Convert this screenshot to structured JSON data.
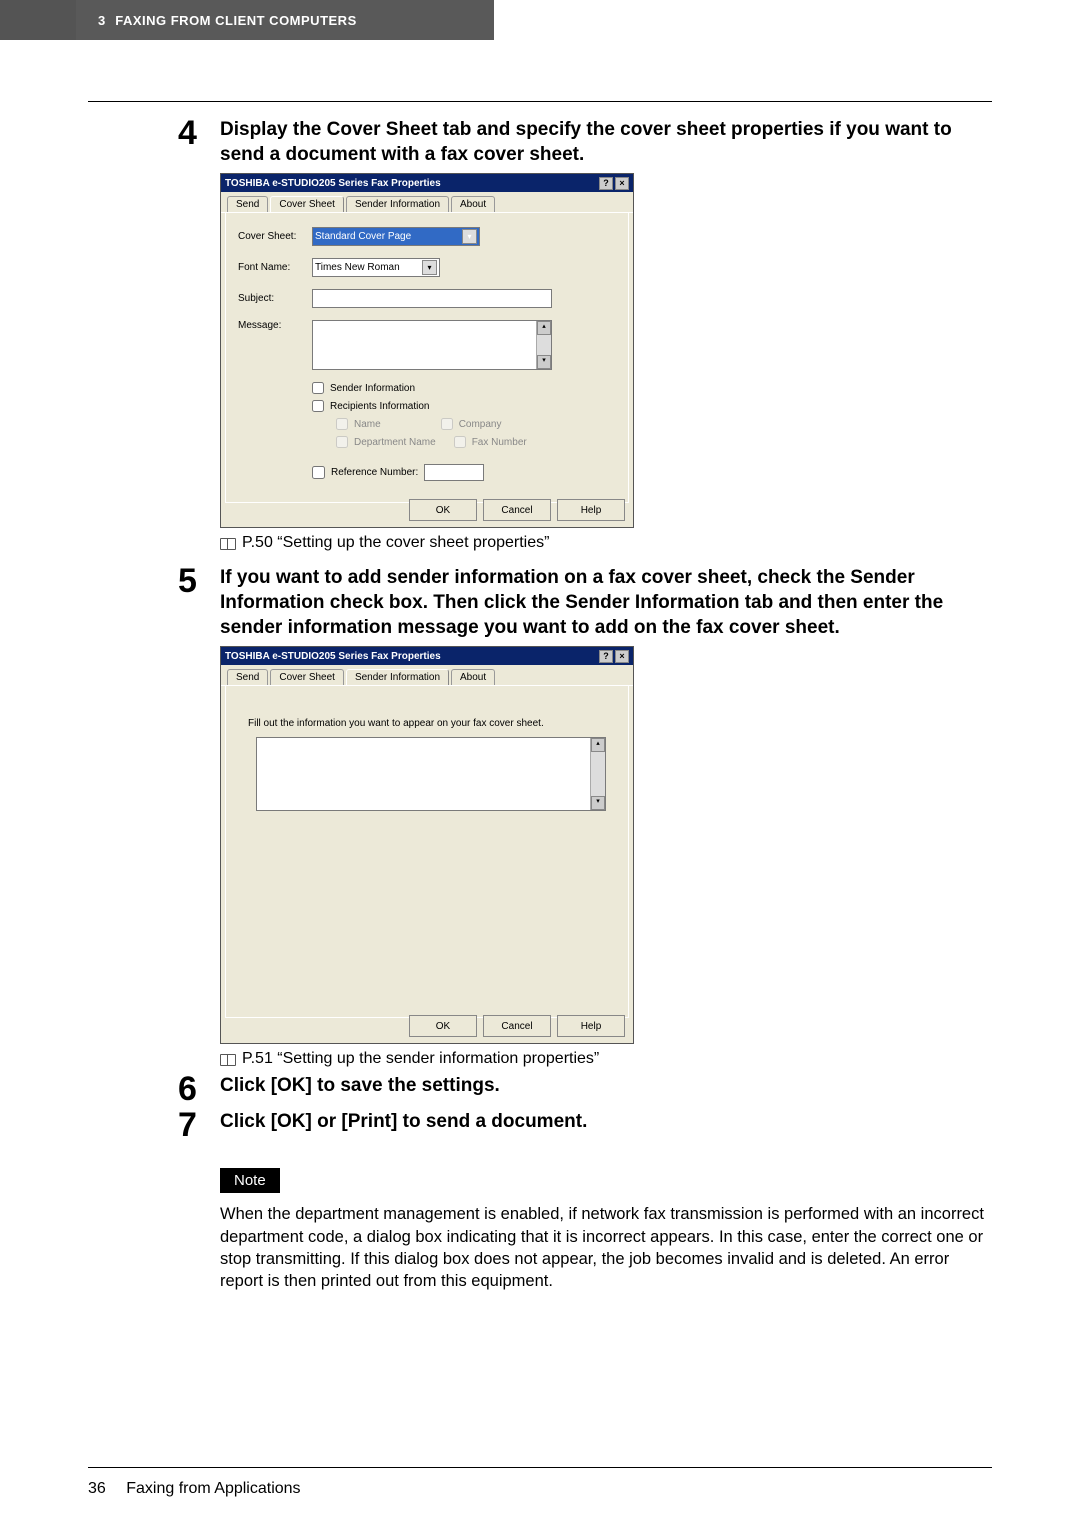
{
  "header": {
    "chapter_num": "3",
    "chapter_title": "FAXING FROM CLIENT COMPUTERS"
  },
  "steps": {
    "s4": {
      "num": "4",
      "text": "Display the Cover Sheet tab and specify the cover sheet properties if you want to send a document with a fax cover sheet."
    },
    "s5": {
      "num": "5",
      "text": "If you want to add sender information on a fax cover sheet, check the Sender Information check box. Then click the Sender Information tab and then enter the sender information message you want to add on the fax cover sheet."
    },
    "s6": {
      "num": "6",
      "text": "Click [OK] to save the settings."
    },
    "s7": {
      "num": "7",
      "text": "Click [OK] or [Print] to send a document."
    }
  },
  "captions": {
    "c1": "P.50 “Setting up the cover sheet properties”",
    "c2": "P.51 “Setting up the sender information properties”"
  },
  "dialog1": {
    "title": "TOSHIBA e-STUDIO205 Series Fax Properties",
    "tabs": {
      "send": "Send",
      "cover": "Cover Sheet",
      "sender": "Sender Information",
      "about": "About"
    },
    "labels": {
      "cover_sheet": "Cover Sheet:",
      "font_name": "Font Name:",
      "subject": "Subject:",
      "message": "Message:",
      "sender_info": "Sender Information",
      "recip_info": "Recipients Information",
      "name": "Name",
      "company": "Company",
      "dept": "Department Name",
      "faxnum": "Fax Number",
      "refnum": "Reference Number:"
    },
    "values": {
      "cover_sheet_val": "Standard Cover Page",
      "font_name_val": "Times New Roman"
    },
    "buttons": {
      "ok": "OK",
      "cancel": "Cancel",
      "help": "Help"
    },
    "winhelp": "?",
    "winclose": "×",
    "arrow": "▾",
    "up": "▴",
    "down": "▾"
  },
  "dialog2": {
    "title": "TOSHIBA e-STUDIO205 Series Fax Properties",
    "tabs": {
      "send": "Send",
      "cover": "Cover Sheet",
      "sender": "Sender Information",
      "about": "About"
    },
    "instr": "Fill out the information you want to appear on your fax cover sheet.",
    "buttons": {
      "ok": "OK",
      "cancel": "Cancel",
      "help": "Help"
    }
  },
  "note": {
    "label": "Note",
    "text": "When the department management is enabled, if network fax transmission is performed with an incorrect department code, a dialog box indicating that it is incorrect appears. In this case, enter the correct one or stop transmitting. If this dialog box does not appear, the job becomes invalid and is deleted. An error report is then printed out from this equipment."
  },
  "footer": {
    "page": "36",
    "section": "Faxing from Applications"
  }
}
